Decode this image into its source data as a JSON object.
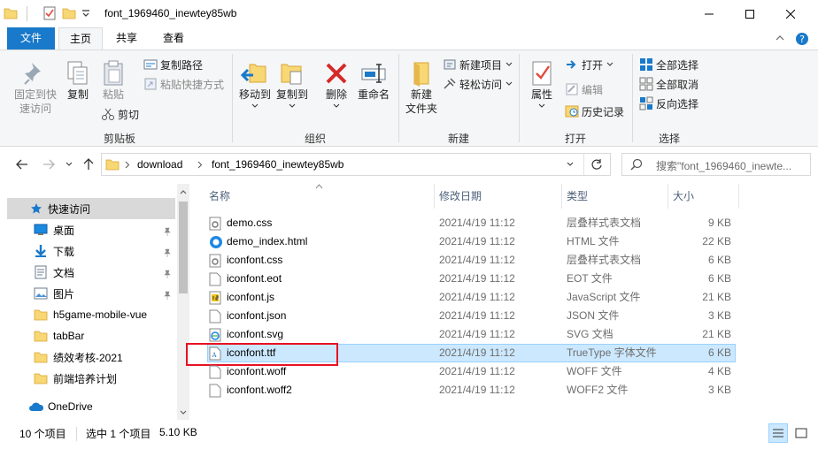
{
  "window": {
    "title": "font_1969460_inewtey85wb",
    "minimize": "─",
    "maximize": "☐",
    "close": "✕"
  },
  "tabs": [
    {
      "label": "文件"
    },
    {
      "label": "主页"
    },
    {
      "label": "共享"
    },
    {
      "label": "查看"
    }
  ],
  "ribbon": {
    "clipboard": {
      "pin_label_1": "固定到快",
      "pin_label_2": "速访问",
      "copy": "复制",
      "paste": "粘贴",
      "copy_path": "复制路径",
      "paste_shortcut": "粘贴快捷方式",
      "cut": "剪切",
      "group": "剪贴板"
    },
    "organize": {
      "move_to": "移动到",
      "copy_to": "复制到",
      "delete": "删除",
      "rename": "重命名",
      "group": "组织"
    },
    "new": {
      "new_folder_1": "新建",
      "new_folder_2": "文件夹",
      "new_item": "新建项目",
      "easy_access": "轻松访问",
      "group": "新建"
    },
    "open": {
      "properties": "属性",
      "open": "打开",
      "edit": "编辑",
      "history": "历史记录",
      "group": "打开"
    },
    "select": {
      "select_all": "全部选择",
      "select_none": "全部取消",
      "invert": "反向选择",
      "group": "选择"
    }
  },
  "address": {
    "crumb_1": "download",
    "crumb_2": "font_1969460_inewtey85wb",
    "search_placeholder": "搜索\"font_1969460_inewte..."
  },
  "nav": {
    "quick_access": "快速访问",
    "items": [
      {
        "label": "桌面"
      },
      {
        "label": "下载"
      },
      {
        "label": "文档"
      },
      {
        "label": "图片"
      },
      {
        "label": "h5game-mobile-vue"
      },
      {
        "label": "tabBar"
      },
      {
        "label": "绩效考核-2021"
      },
      {
        "label": "前端培养计划"
      }
    ],
    "onedrive": "OneDrive"
  },
  "columns": {
    "name": "名称",
    "modified": "修改日期",
    "type": "类型",
    "size": "大小"
  },
  "files": [
    {
      "name": "demo.css",
      "modified": "2021/4/19 11:12",
      "type": "层叠样式表文档",
      "size": "9 KB"
    },
    {
      "name": "demo_index.html",
      "modified": "2021/4/19 11:12",
      "type": "HTML 文件",
      "size": "22 KB"
    },
    {
      "name": "iconfont.css",
      "modified": "2021/4/19 11:12",
      "type": "层叠样式表文档",
      "size": "6 KB"
    },
    {
      "name": "iconfont.eot",
      "modified": "2021/4/19 11:12",
      "type": "EOT 文件",
      "size": "6 KB"
    },
    {
      "name": "iconfont.js",
      "modified": "2021/4/19 11:12",
      "type": "JavaScript 文件",
      "size": "21 KB"
    },
    {
      "name": "iconfont.json",
      "modified": "2021/4/19 11:12",
      "type": "JSON 文件",
      "size": "3 KB"
    },
    {
      "name": "iconfont.svg",
      "modified": "2021/4/19 11:12",
      "type": "SVG 文档",
      "size": "21 KB"
    },
    {
      "name": "iconfont.ttf",
      "modified": "2021/4/19 11:12",
      "type": "TrueType 字体文件",
      "size": "6 KB"
    },
    {
      "name": "iconfont.woff",
      "modified": "2021/4/19 11:12",
      "type": "WOFF 文件",
      "size": "4 KB"
    },
    {
      "name": "iconfont.woff2",
      "modified": "2021/4/19 11:12",
      "type": "WOFF2 文件",
      "size": "3 KB"
    }
  ],
  "status": {
    "count": "10 个项目",
    "selection": "选中 1 个项目",
    "size": "5.10 KB"
  },
  "colors": {
    "accent": "#1979ca",
    "selection_bg": "#cce8ff",
    "highlight_box": "#e81123"
  }
}
